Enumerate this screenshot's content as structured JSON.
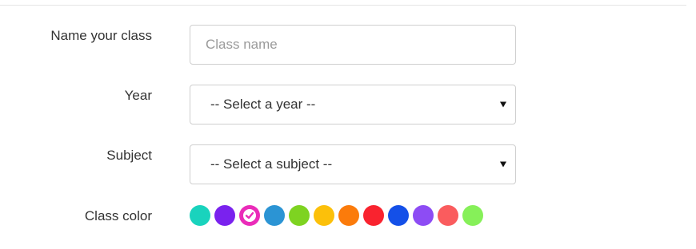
{
  "form": {
    "name": {
      "label": "Name your class",
      "placeholder": "Class name",
      "value": ""
    },
    "year": {
      "label": "Year",
      "selected": "-- Select a year --"
    },
    "subject": {
      "label": "Subject",
      "selected": "-- Select a subject --"
    },
    "color": {
      "label": "Class color",
      "selected_index": 2,
      "swatches": [
        "#19d3bd",
        "#7a22ee",
        "#ea2cb9",
        "#2b94d4",
        "#7ed321",
        "#fcc00a",
        "#fb7b0b",
        "#f9232f",
        "#1450e8",
        "#8d4cf4",
        "#fa5c5e",
        "#86f059"
      ]
    }
  }
}
